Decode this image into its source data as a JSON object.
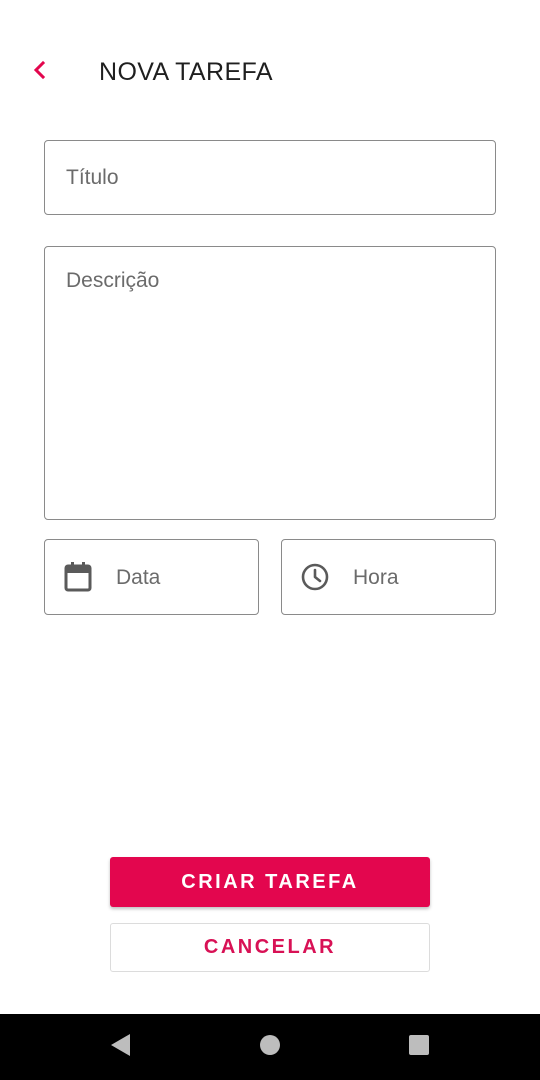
{
  "header": {
    "title": "NOVA TAREFA",
    "back_icon": "chevron-left-icon",
    "accent_color": "#e3064e"
  },
  "form": {
    "title_placeholder": "Título",
    "description_placeholder": "Descrição",
    "date_label": "Data",
    "date_icon": "calendar-icon",
    "time_label": "Hora",
    "time_icon": "clock-icon"
  },
  "actions": {
    "create_label": "CRIAR TAREFA",
    "cancel_label": "CANCELAR",
    "primary_color": "#e3064e",
    "secondary_text_color": "#d81155"
  },
  "system_nav": {
    "back_icon": "nav-back-icon",
    "home_icon": "nav-home-icon",
    "recents_icon": "nav-recents-icon"
  }
}
